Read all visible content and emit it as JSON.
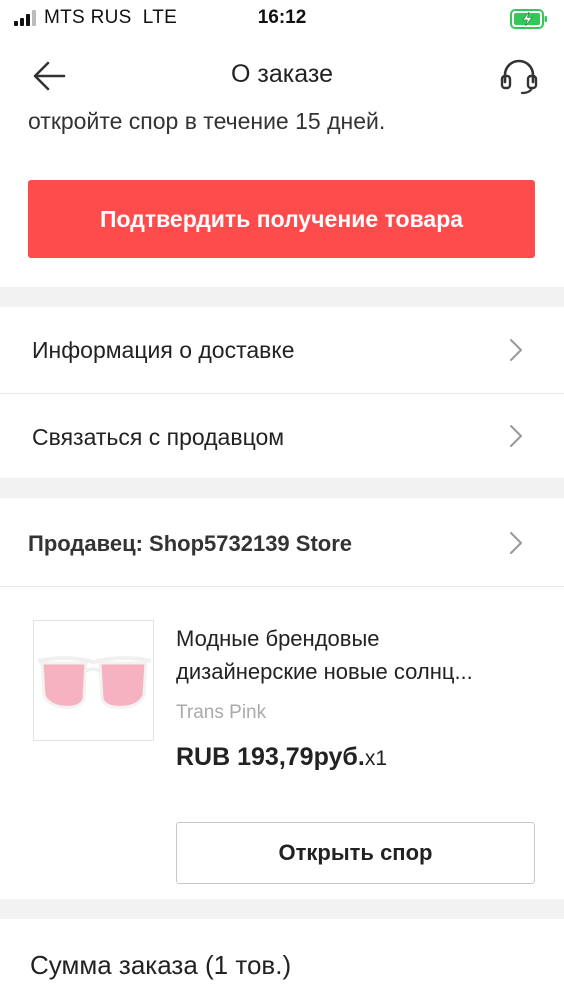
{
  "status_bar": {
    "carrier": "MTS RUS",
    "network": "LTE",
    "time": "16:12",
    "signal_icon": "signal-bars-icon",
    "battery_icon": "battery-charging-icon",
    "battery_color": "#34c759"
  },
  "header": {
    "title": "О заказе",
    "back_icon": "arrow-left-icon",
    "support_icon": "headset-icon"
  },
  "notice": {
    "text": "откройте спор в течение 15 дней."
  },
  "confirm_button": {
    "label": "Подтвердить получение товара",
    "color": "#fe4c4c"
  },
  "menu": {
    "items": [
      {
        "label": "Информация о доставке"
      },
      {
        "label": "Связаться с продавцом"
      }
    ],
    "chevron_icon": "chevron-right-icon"
  },
  "seller": {
    "label": "Продавец: Shop5732139 Store"
  },
  "product": {
    "title_line1": "Модные брендовые",
    "title_line2": "дизайнерские новые солнц...",
    "variant": "Trans Pink",
    "price": "RUB 193,79руб.",
    "quantity": "x1",
    "image_icon": "pink-sunglasses-image"
  },
  "dispute_button": {
    "label": "Открыть спор"
  },
  "order_summary": {
    "label": "Сумма заказа (1 тов.)"
  }
}
